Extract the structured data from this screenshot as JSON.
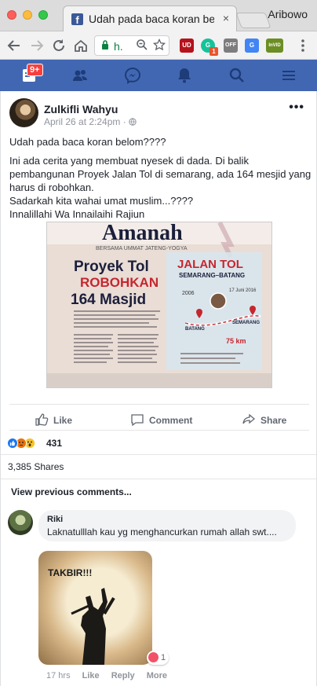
{
  "browser": {
    "tab_title": "Udah pada baca koran belom",
    "tab_close": "×",
    "tab_favicon": "f",
    "profile_name": "Aribowo",
    "omnibox_text": "h.",
    "extensions": [
      {
        "name": "ublock",
        "label": "UD",
        "color": "#b5121b"
      },
      {
        "name": "grammarly",
        "label": "G",
        "color": "#15c39a",
        "badge": "1"
      },
      {
        "name": "off",
        "label": "OFF",
        "color": "#7d7d7d"
      },
      {
        "name": "google-translate",
        "label": "G",
        "color": "#4285f4"
      },
      {
        "name": "invid",
        "label": "InVID",
        "color": "#6b8e23"
      }
    ]
  },
  "fb_nav": {
    "notification_count": "9+",
    "brand_color": "#4267b2"
  },
  "post": {
    "author": "Zulkifli Wahyu",
    "date": "April 26 at 2:24pm",
    "separator": "·",
    "more_label": "•••",
    "text_headline": "Udah pada baca koran belom????",
    "text_lines": [
      "Ini ada cerita yang membuat nyesek di dada. Di balik pembangunan Proyek Jalan Tol di semarang, ada 164 mesjid yang harus di robohkan.",
      "Sadarkah kita wahai umat muslim...????",
      "Innalillahi Wa Innailaihi Rajiun"
    ],
    "newspaper": {
      "masthead": "Amanah",
      "tagline": "BERSAMA UMMAT  JATENG-YOGYA",
      "headline_1": "Proyek Tol",
      "headline_2": "ROBOHKAN",
      "headline_3": "164 Masjid",
      "box_title": "JALAN TOL",
      "box_subtitle": "SEMARANG–BATANG",
      "distance": "75 km",
      "date_label": "17 Juni 2016",
      "year_label": "2006",
      "city_1": "BATANG",
      "city_2": "SEMARANG"
    },
    "actions": {
      "like": "Like",
      "comment": "Comment",
      "share": "Share"
    },
    "reaction_count": "431",
    "shares": "3,385 Shares",
    "view_previous": "View previous comments..."
  },
  "comment": {
    "author": "Riki",
    "text": "Laknatulllah kau yg menghancurkan rumah allah swt....",
    "image_caption": "TAKBIR!!!",
    "reaction_count": "1",
    "time": "17 hrs",
    "like": "Like",
    "reply": "Reply",
    "more": "More"
  }
}
